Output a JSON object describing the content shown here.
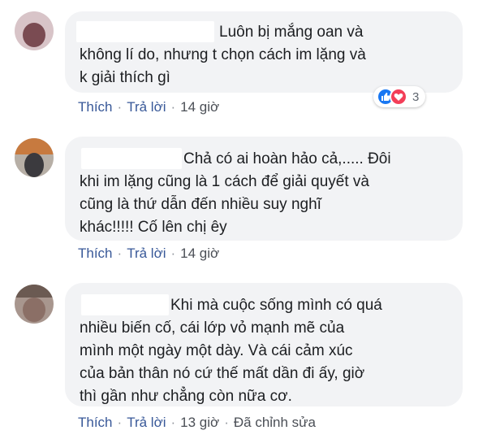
{
  "comments": [
    {
      "lines": [
        "Luôn bị mắng oan và",
        "không lí do, nhưng t chọn cách im lặng và",
        "k giải thích gì"
      ],
      "actions": {
        "like": "Thích",
        "reply": "Trả lời",
        "time": "14 giờ"
      },
      "reactions": {
        "count": "3",
        "icons": [
          "like-icon",
          "love-icon"
        ],
        "colors": [
          "#1877f2",
          "#f33e58"
        ]
      }
    },
    {
      "lines": [
        "Chả có ai hoàn hảo cả,..... Đôi",
        "khi im lặng cũng là 1 cách để giải quyết và",
        "cũng là thứ dẫn đến nhiều suy nghĩ",
        "khác!!!!! Cố lên chị êy"
      ],
      "actions": {
        "like": "Thích",
        "reply": "Trả lời",
        "time": "14 giờ"
      }
    },
    {
      "lines": [
        "Khi mà cuộc sống mình có quá",
        "nhiều biến cố, cái lớp vỏ mạnh mẽ của",
        "mình một ngày một dày. Và cái cảm xúc",
        "của bản thân nó cứ thế mất dần đi ấy, giờ",
        "thì gần như chẳng còn nữa cơ."
      ],
      "actions": {
        "like": "Thích",
        "reply": "Trả lời",
        "time": "13 giờ",
        "edited": "Đã chỉnh sửa"
      }
    }
  ],
  "colors": {
    "bubble": "#f2f3f5",
    "link": "#385898",
    "meta": "#4b4f56"
  }
}
